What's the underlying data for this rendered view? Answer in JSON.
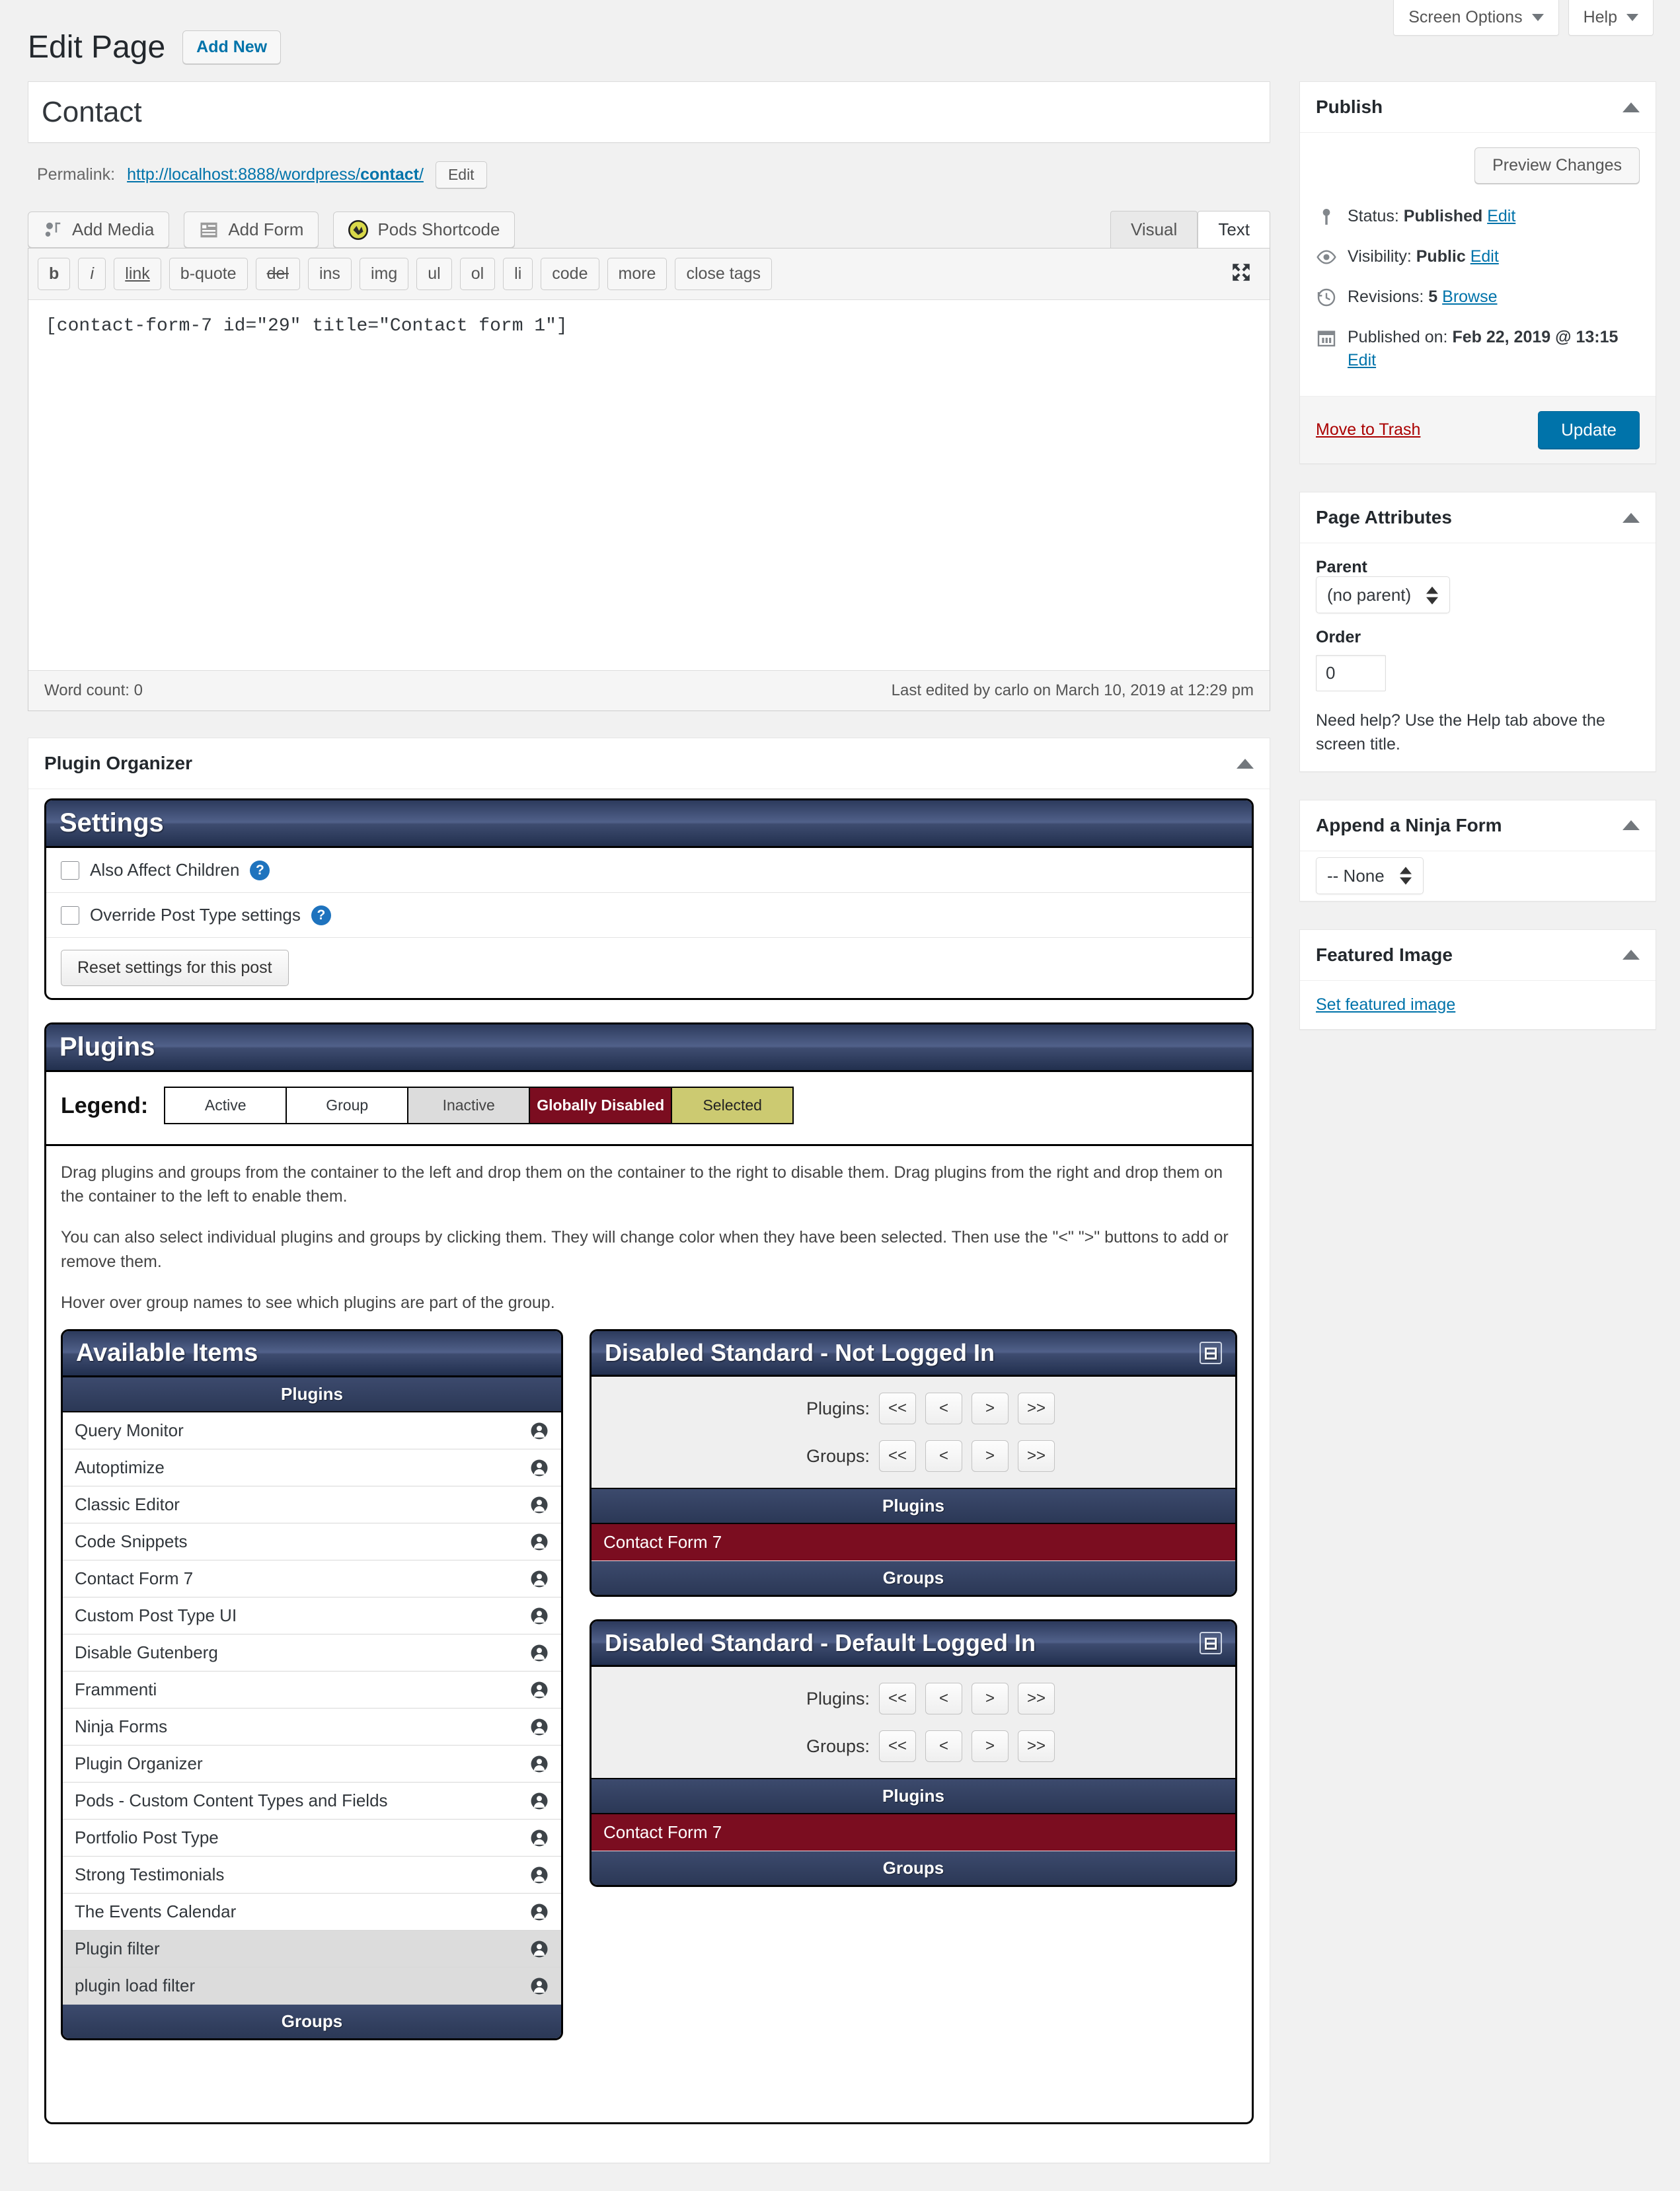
{
  "screen_meta": {
    "screen_options": "Screen Options",
    "help": "Help"
  },
  "header": {
    "title": "Edit Page",
    "add_new": "Add New"
  },
  "post": {
    "title_value": "Contact",
    "permalink_label": "Permalink:",
    "permalink_base": "http://localhost:8888/wordpress/",
    "permalink_slug": "contact",
    "permalink_tail": "/",
    "edit_slug_button": "Edit"
  },
  "editor": {
    "media_buttons": [
      {
        "label": "Add Media",
        "icon": "add-media-icon"
      },
      {
        "label": "Add Form",
        "icon": "add-form-icon"
      },
      {
        "label": "Pods Shortcode",
        "icon": "pods-shortcode-icon"
      }
    ],
    "tabs": [
      {
        "label": "Visual",
        "active": false
      },
      {
        "label": "Text",
        "active": true
      }
    ],
    "quicktags": [
      "b",
      "i",
      "link",
      "b-quote",
      "del",
      "ins",
      "img",
      "ul",
      "ol",
      "li",
      "code",
      "more",
      "close tags"
    ],
    "fullscreen_icon": "fullscreen-icon",
    "content": "[contact-form-7 id=\"29\" title=\"Contact form 1\"]",
    "word_count": "Word count: 0",
    "last_edited": "Last edited by carlo on March 10, 2019 at 12:29 pm"
  },
  "publish": {
    "title": "Publish",
    "preview_changes": "Preview Changes",
    "status_label": "Status:",
    "status_value": "Published",
    "status_edit": "Edit",
    "visibility_label": "Visibility:",
    "visibility_value": "Public",
    "visibility_edit": "Edit",
    "revisions_label": "Revisions:",
    "revisions_count": "5",
    "revisions_browse": "Browse",
    "published_label": "Published on:",
    "published_value": "Feb 22, 2019 @ 13:15",
    "published_edit": "Edit",
    "trash": "Move to Trash",
    "update": "Update"
  },
  "page_attributes": {
    "title": "Page Attributes",
    "parent_label": "Parent",
    "parent_value": "(no parent)",
    "order_label": "Order",
    "order_value": "0",
    "help_note": "Need help? Use the Help tab above the screen title."
  },
  "ninja_form": {
    "title": "Append a Ninja Form",
    "value": "-- None"
  },
  "featured_image": {
    "title": "Featured Image",
    "set_link": "Set featured image"
  },
  "plugin_organizer": {
    "title": "Plugin Organizer",
    "settings": {
      "heading": "Settings",
      "also_affect_children": "Also Affect Children",
      "override_post_type": "Override Post Type settings",
      "reset_button": "Reset settings for this post"
    },
    "plugins_panel": {
      "heading": "Plugins",
      "legend_label": "Legend:",
      "legend": [
        {
          "label": "Active",
          "key": "active",
          "color": "#ffffff"
        },
        {
          "label": "Group",
          "key": "group",
          "color": "#ffffff"
        },
        {
          "label": "Inactive",
          "key": "inactive",
          "color": "#dcdcdc"
        },
        {
          "label": "Globally Disabled",
          "key": "gdisabled",
          "color": "#7b0d20"
        },
        {
          "label": "Selected",
          "key": "selected",
          "color": "#ccca71"
        }
      ],
      "instructions": [
        "Drag plugins and groups from the container to the left and drop them on the container to the right to disable them. Drag plugins from the right and drop them on the container to the left to enable them.",
        "You can also select individual plugins and groups by clicking them. They will change color when they have been selected. Then use the \"<\" \">\" buttons to add or remove them.",
        "Hover over group names to see which plugins are part of the group."
      ],
      "available": {
        "heading": "Available Items",
        "plugins_subhead": "Plugins",
        "groups_subhead": "Groups",
        "items": [
          {
            "name": "Query Monitor",
            "state": "active"
          },
          {
            "name": "Autoptimize",
            "state": "active"
          },
          {
            "name": "Classic Editor",
            "state": "active"
          },
          {
            "name": "Code Snippets",
            "state": "active"
          },
          {
            "name": "Contact Form 7",
            "state": "active"
          },
          {
            "name": "Custom Post Type UI",
            "state": "active"
          },
          {
            "name": "Disable Gutenberg",
            "state": "active"
          },
          {
            "name": "Frammenti",
            "state": "active"
          },
          {
            "name": "Ninja Forms",
            "state": "active"
          },
          {
            "name": "Plugin Organizer",
            "state": "active"
          },
          {
            "name": "Pods - Custom Content Types and Fields",
            "state": "active"
          },
          {
            "name": "Portfolio Post Type",
            "state": "active"
          },
          {
            "name": "Strong Testimonials",
            "state": "active"
          },
          {
            "name": "The Events Calendar",
            "state": "active"
          },
          {
            "name": "Plugin filter",
            "state": "inactive"
          },
          {
            "name": "plugin load filter",
            "state": "inactive"
          }
        ]
      },
      "disabled_panels": [
        {
          "heading": "Disabled Standard - Not Logged In",
          "plugins_move_label": "Plugins:",
          "groups_move_label": "Groups:",
          "move_buttons": [
            "<<",
            "<",
            ">",
            ">>"
          ],
          "plugins_subhead": "Plugins",
          "groups_subhead": "Groups",
          "items": [
            {
              "name": "Contact Form 7",
              "state": "disabled"
            }
          ]
        },
        {
          "heading": "Disabled Standard - Default Logged In",
          "plugins_move_label": "Plugins:",
          "groups_move_label": "Groups:",
          "move_buttons": [
            "<<",
            "<",
            ">",
            ">>"
          ],
          "plugins_subhead": "Plugins",
          "groups_subhead": "Groups",
          "items": [
            {
              "name": "Contact Form 7",
              "state": "disabled"
            }
          ]
        }
      ]
    }
  }
}
